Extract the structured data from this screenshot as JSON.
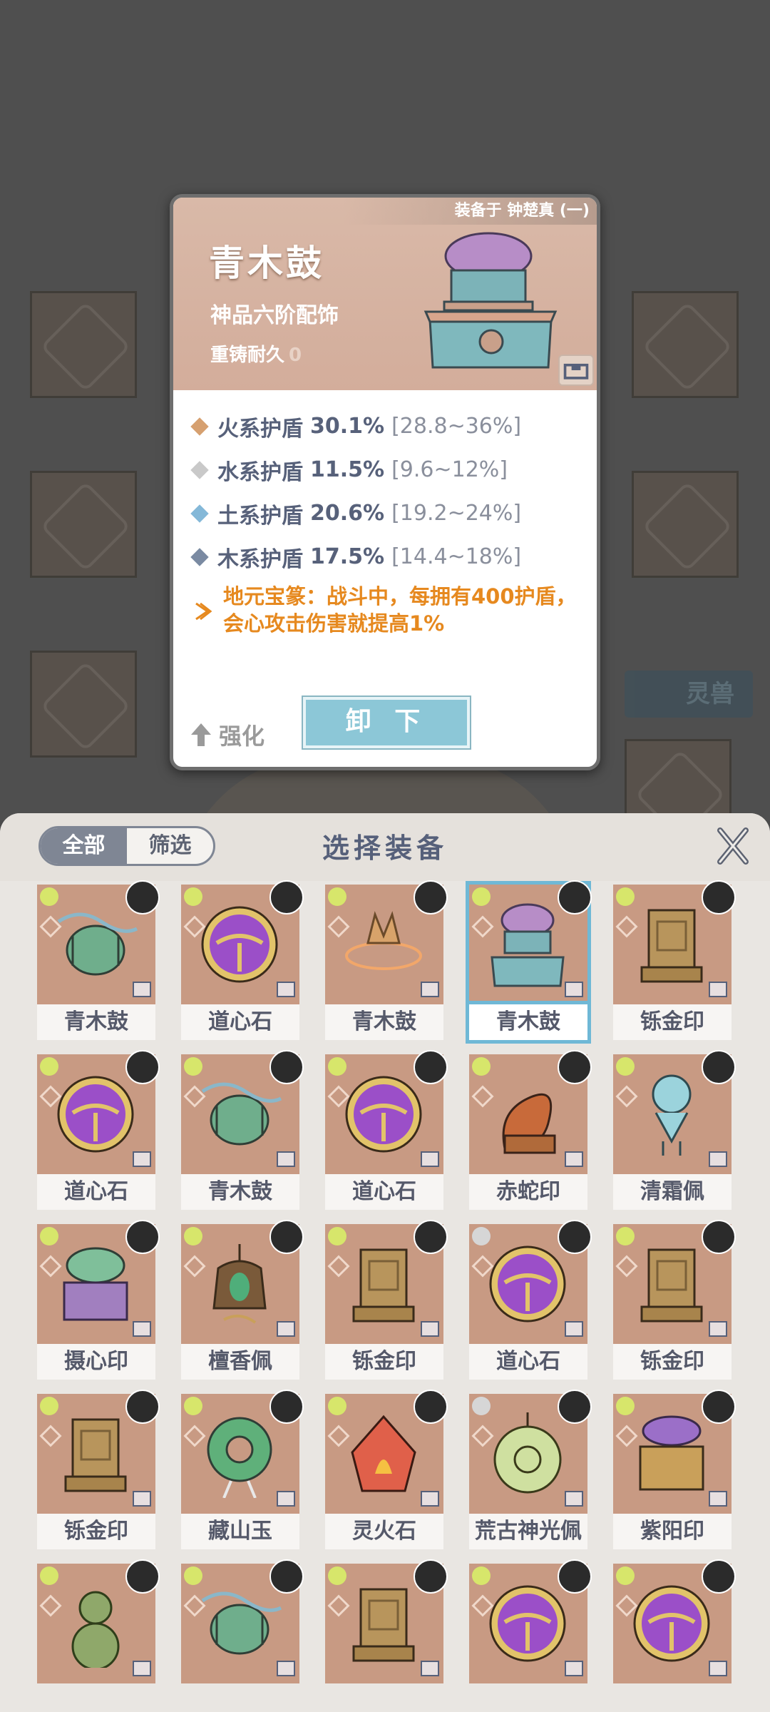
{
  "background": {
    "panel_tab": "灵兽"
  },
  "detail": {
    "equipped_on": "装备于 钟楚真 (一)",
    "name": "青木鼓",
    "grade": "神品六阶配饰",
    "durability_label": "重铸耐久",
    "durability_value": "0",
    "stats": [
      {
        "name": "火系护盾",
        "value": "30.1%",
        "range": "[28.8~36%]",
        "color": "#d6a070"
      },
      {
        "name": "水系护盾",
        "value": "11.5%",
        "range": "[9.6~12%]",
        "color": "#c9c9c9"
      },
      {
        "name": "土系护盾",
        "value": "20.6%",
        "range": "[19.2~24%]",
        "color": "#84b8d8"
      },
      {
        "name": "木系护盾",
        "value": "17.5%",
        "range": "[14.4~18%]",
        "color": "#7a8aa2"
      }
    ],
    "special": "地元宝篆：战斗中，每拥有400护盾，会心攻击伤害就提高1%",
    "enhance_label": "强化",
    "unequip_label": "卸 下"
  },
  "panel": {
    "title": "选择装备",
    "filter_all": "全部",
    "filter_select": "筛选",
    "items": [
      {
        "label": "青木鼓",
        "art": "drum"
      },
      {
        "label": "道心石",
        "art": "orb"
      },
      {
        "label": "青木鼓",
        "art": "flame"
      },
      {
        "label": "青木鼓",
        "art": "censer",
        "selected": true
      },
      {
        "label": "铄金印",
        "art": "seal"
      },
      {
        "label": "道心石",
        "art": "orb"
      },
      {
        "label": "青木鼓",
        "art": "drum"
      },
      {
        "label": "道心石",
        "art": "orb"
      },
      {
        "label": "赤蛇印",
        "art": "snake"
      },
      {
        "label": "清霜佩",
        "art": "pendant"
      },
      {
        "label": "摄心印",
        "art": "jade-box"
      },
      {
        "label": "檀香佩",
        "art": "bell"
      },
      {
        "label": "铄金印",
        "art": "seal"
      },
      {
        "label": "道心石",
        "art": "orb"
      },
      {
        "label": "铄金印",
        "art": "seal"
      },
      {
        "label": "铄金印",
        "art": "seal"
      },
      {
        "label": "藏山玉",
        "art": "jade-ring"
      },
      {
        "label": "灵火石",
        "art": "fire-stone"
      },
      {
        "label": "荒古神光佩",
        "art": "amulet"
      },
      {
        "label": "紫阳印",
        "art": "purple-box"
      },
      {
        "label": "",
        "art": "gourd"
      },
      {
        "label": "",
        "art": "drum"
      },
      {
        "label": "",
        "art": "seal"
      },
      {
        "label": "",
        "art": "orb"
      },
      {
        "label": "",
        "art": "orb"
      }
    ]
  }
}
